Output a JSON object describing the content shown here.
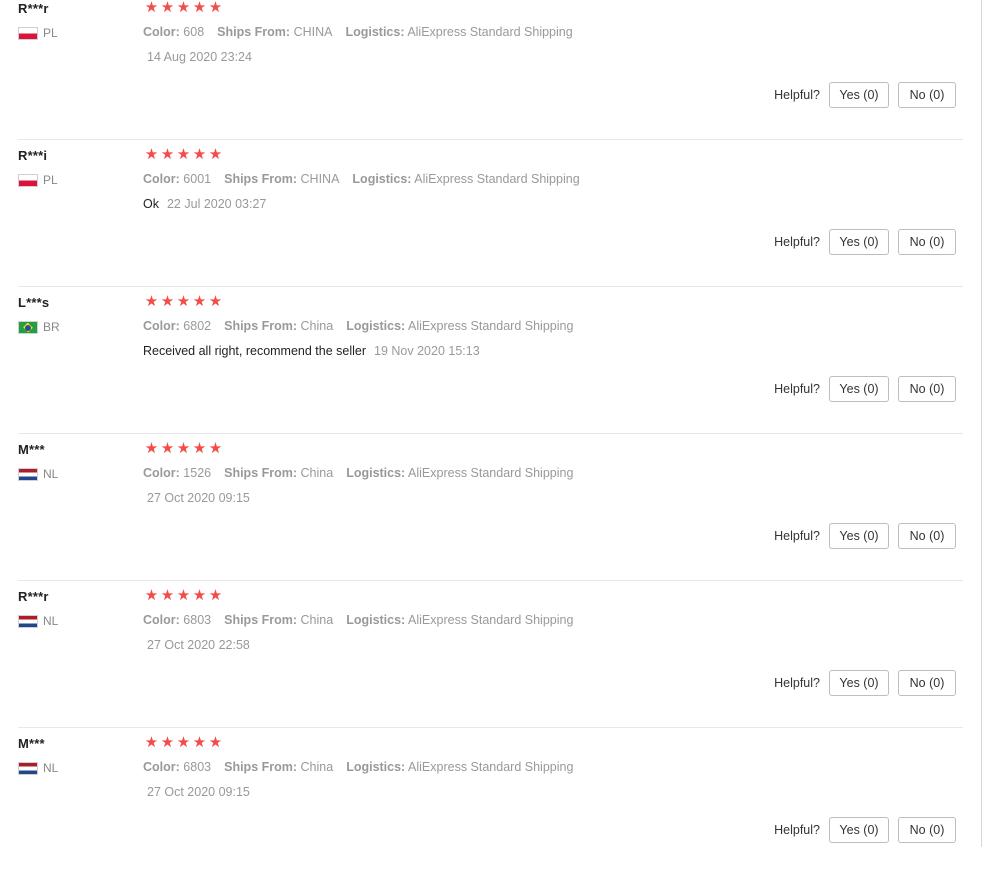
{
  "helpful_label": "Helpful?",
  "colors": {
    "star": "#f24d4b",
    "meta_text": "#999999",
    "divider": "#e8e8e8"
  },
  "reviews": [
    {
      "user": "R***r",
      "country": "PL",
      "flag": "pl",
      "rating": 5,
      "color_label": "Color:",
      "color_value": "608",
      "ships_label": "Ships From:",
      "ships_value": "CHINA",
      "logistics_label": "Logistics:",
      "logistics_value": "AliExpress Standard Shipping",
      "comment": "",
      "date": "14 Aug 2020 23:24",
      "yes": "Yes (0)",
      "no": "No (0)"
    },
    {
      "user": "R***i",
      "country": "PL",
      "flag": "pl",
      "rating": 5,
      "color_label": "Color:",
      "color_value": "6001",
      "ships_label": "Ships From:",
      "ships_value": "CHINA",
      "logistics_label": "Logistics:",
      "logistics_value": "AliExpress Standard Shipping",
      "comment": "Ok",
      "date": "22 Jul 2020 03:27",
      "yes": "Yes (0)",
      "no": "No (0)"
    },
    {
      "user": "L***s",
      "country": "BR",
      "flag": "br",
      "rating": 5,
      "color_label": "Color:",
      "color_value": "6802",
      "ships_label": "Ships From:",
      "ships_value": "China",
      "logistics_label": "Logistics:",
      "logistics_value": "AliExpress Standard Shipping",
      "comment": "Received all right, recommend the seller",
      "date": "19 Nov 2020 15:13",
      "yes": "Yes (0)",
      "no": "No (0)"
    },
    {
      "user": "M***",
      "country": "NL",
      "flag": "nl",
      "rating": 5,
      "color_label": "Color:",
      "color_value": "1526",
      "ships_label": "Ships From:",
      "ships_value": "China",
      "logistics_label": "Logistics:",
      "logistics_value": "AliExpress Standard Shipping",
      "comment": "",
      "date": "27 Oct 2020 09:15",
      "yes": "Yes (0)",
      "no": "No (0)"
    },
    {
      "user": "R***r",
      "country": "NL",
      "flag": "nl",
      "rating": 5,
      "color_label": "Color:",
      "color_value": "6803",
      "ships_label": "Ships From:",
      "ships_value": "China",
      "logistics_label": "Logistics:",
      "logistics_value": "AliExpress Standard Shipping",
      "comment": "",
      "date": "27 Oct 2020 22:58",
      "yes": "Yes (0)",
      "no": "No (0)"
    },
    {
      "user": "M***",
      "country": "NL",
      "flag": "nl",
      "rating": 5,
      "color_label": "Color:",
      "color_value": "6803",
      "ships_label": "Ships From:",
      "ships_value": "China",
      "logistics_label": "Logistics:",
      "logistics_value": "AliExpress Standard Shipping",
      "comment": "",
      "date": "27 Oct 2020 09:15",
      "yes": "Yes (0)",
      "no": "No (0)"
    }
  ]
}
